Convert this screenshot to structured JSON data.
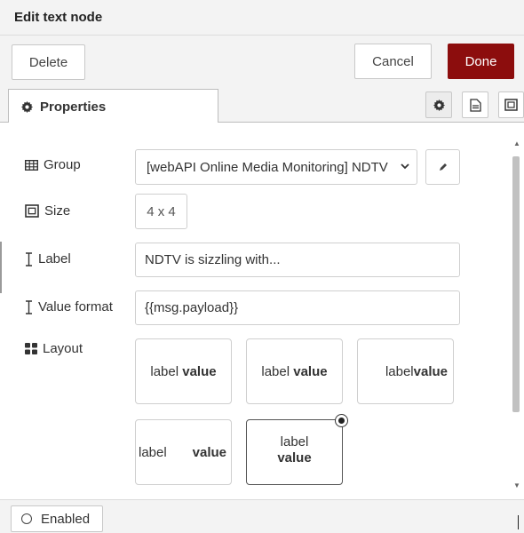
{
  "tray": {
    "title": "Edit text node"
  },
  "toolbar": {
    "delete_label": "Delete",
    "cancel_label": "Cancel",
    "done_label": "Done"
  },
  "tabs": {
    "active_label": "Properties",
    "icons": [
      "gear-icon",
      "document-icon",
      "frame-icon"
    ]
  },
  "form": {
    "group": {
      "label": "Group",
      "value": "[webAPI Online Media Monitoring] NDTV"
    },
    "size": {
      "label": "Size",
      "value": "4 x 4"
    },
    "label_field": {
      "label": "Label",
      "value": "NDTV is sizzling with..."
    },
    "value_format": {
      "label": "Value format",
      "value": "{{msg.payload}}"
    },
    "layout": {
      "label": "Layout",
      "options": [
        {
          "label": "label",
          "value": "value"
        },
        {
          "label": "label",
          "value": "value"
        },
        {
          "label": "label",
          "value": "value"
        },
        {
          "label": "label",
          "value": "value"
        },
        {
          "label": "label",
          "value": "value",
          "selected": true
        }
      ]
    }
  },
  "footer": {
    "enabled_label": "Enabled"
  },
  "colors": {
    "done_button": "#8c0d0d",
    "tray_bg": "#f3f3f3"
  }
}
